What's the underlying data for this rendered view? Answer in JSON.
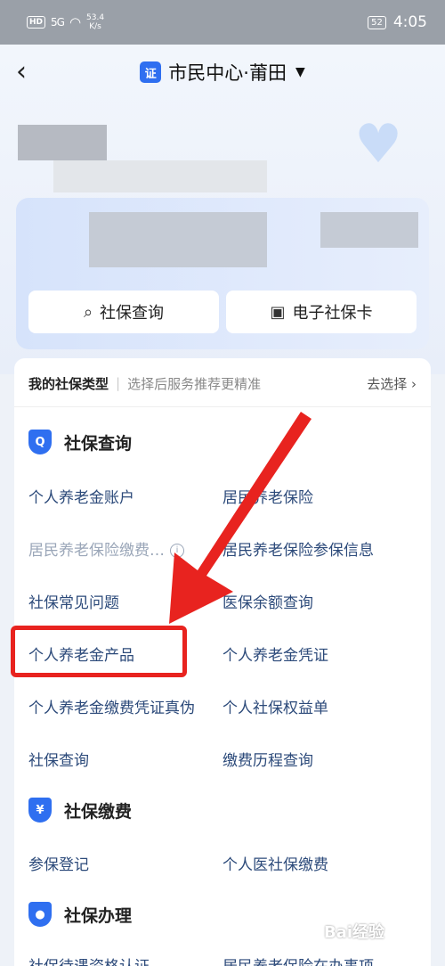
{
  "status_bar": {
    "hd": "HD",
    "signal": "5G",
    "speed": "53.4",
    "speed_unit": "K/s",
    "battery": "52",
    "time": "4:05"
  },
  "nav": {
    "title": "市民中心·莆田",
    "back_icon": "chevron-left-icon",
    "caret_icon": "caret-down-icon"
  },
  "quick_actions": [
    {
      "label": "社保查询",
      "icon": "search-icon"
    },
    {
      "label": "电子社保卡",
      "icon": "id-card-icon"
    }
  ],
  "type_selector": {
    "title": "我的社保类型",
    "hint": "选择后服务推荐更精准",
    "action": "去选择"
  },
  "sections": [
    {
      "title": "社保查询",
      "icon": "shield-icon",
      "items": [
        "个人养老金账户",
        "居民养老保险",
        "居民养老保险缴费…",
        "居民养老保险参保信息",
        "社保常见问题",
        "医保余额查询",
        "个人养老金产品",
        "个人养老金凭证",
        "个人养老金缴费凭证真伪",
        "个人社保权益单",
        "社保查询",
        "缴费历程查询"
      ]
    },
    {
      "title": "社保缴费",
      "icon": "yen-shield-icon",
      "items": [
        "参保登记",
        "个人医社保缴费"
      ]
    },
    {
      "title": "社保办理",
      "icon": "person-shield-icon",
      "items": [
        "社保待遇资格认证",
        "居民养老保险在办事项"
      ]
    }
  ],
  "colors": {
    "accent": "#2f6ff0",
    "highlight": "#e8231f",
    "link": "#2c4a7a"
  },
  "watermark": "Bai经验"
}
